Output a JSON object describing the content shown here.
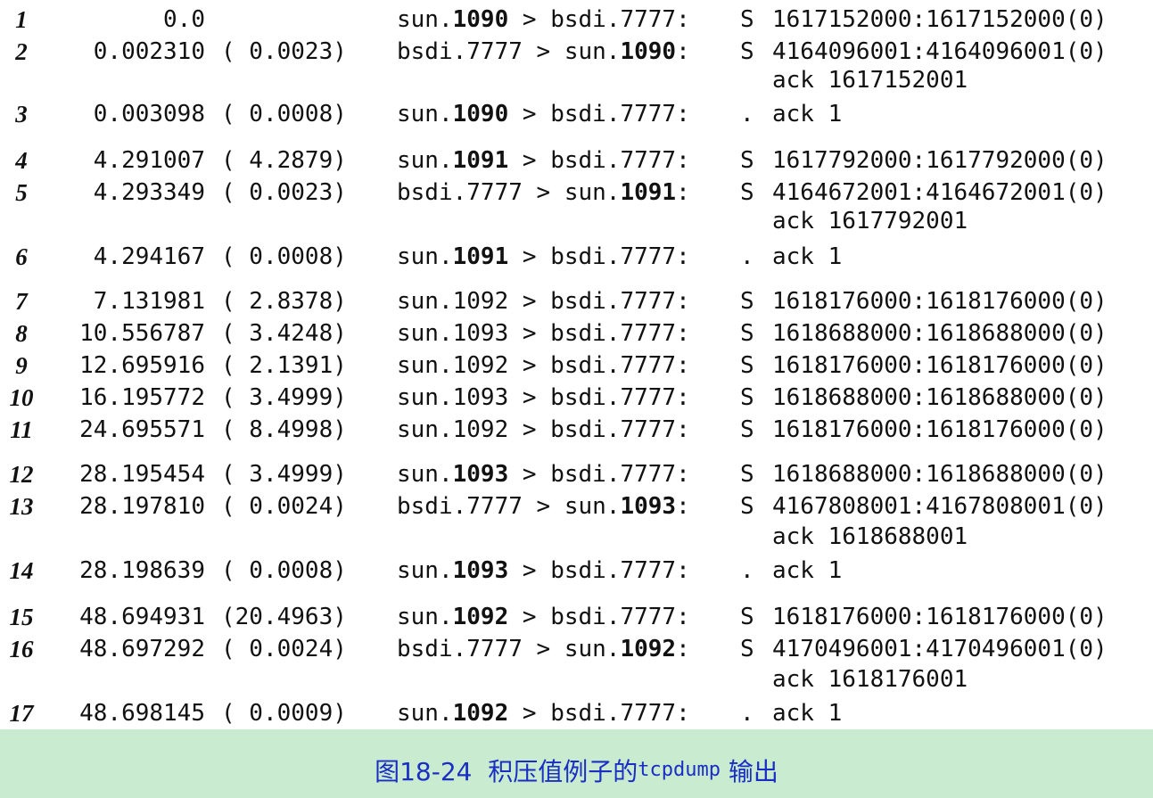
{
  "lines": [
    {
      "n": "1",
      "time": "0.0",
      "delta": "",
      "pre": "sun.",
      "port": "1090",
      "post": " > bsdi.7777:",
      "flag": "S",
      "info": "1617152000:1617152000(0)"
    },
    {
      "n": "2",
      "time": "0.002310",
      "delta": "( 0.0023)",
      "pre": "bsdi.7777 > sun.",
      "port": "1090",
      "post": ":",
      "flag": "S",
      "info": "4164096001:4164096001(0)"
    },
    {
      "n": "",
      "time": "",
      "delta": "",
      "pre": "",
      "port": "",
      "post": "",
      "flag": "",
      "info": "ack 1617152001"
    },
    {
      "n": "3",
      "time": "0.003098",
      "delta": "( 0.0008)",
      "pre": "sun.",
      "port": "1090",
      "post": " > bsdi.7777:",
      "flag": ".",
      "info": "ack 1"
    },
    {
      "n": "4",
      "time": "4.291007",
      "delta": "( 4.2879)",
      "pre": "sun.",
      "port": "1091",
      "post": " > bsdi.7777:",
      "flag": "S",
      "info": "1617792000:1617792000(0)"
    },
    {
      "n": "5",
      "time": "4.293349",
      "delta": "( 0.0023)",
      "pre": "bsdi.7777 > sun.",
      "port": "1091",
      "post": ":",
      "flag": "S",
      "info": "4164672001:4164672001(0)"
    },
    {
      "n": "",
      "time": "",
      "delta": "",
      "pre": "",
      "port": "",
      "post": "",
      "flag": "",
      "info": "ack 1617792001"
    },
    {
      "n": "6",
      "time": "4.294167",
      "delta": "( 0.0008)",
      "pre": "sun.",
      "port": "1091",
      "post": " > bsdi.7777:",
      "flag": ".",
      "info": "ack 1"
    },
    {
      "n": "7",
      "time": "7.131981",
      "delta": "( 2.8378)",
      "pre": "sun.1092 > bsdi.7777:",
      "port": "",
      "post": "",
      "flag": "S",
      "info": "1618176000:1618176000(0)"
    },
    {
      "n": "8",
      "time": "10.556787",
      "delta": "( 3.4248)",
      "pre": "sun.1093 > bsdi.7777:",
      "port": "",
      "post": "",
      "flag": "S",
      "info": "1618688000:1618688000(0)"
    },
    {
      "n": "9",
      "time": "12.695916",
      "delta": "( 2.1391)",
      "pre": "sun.1092 > bsdi.7777:",
      "port": "",
      "post": "",
      "flag": "S",
      "info": "1618176000:1618176000(0)"
    },
    {
      "n": "10",
      "time": "16.195772",
      "delta": "( 3.4999)",
      "pre": "sun.1093 > bsdi.7777:",
      "port": "",
      "post": "",
      "flag": "S",
      "info": "1618688000:1618688000(0)"
    },
    {
      "n": "11",
      "time": "24.695571",
      "delta": "( 8.4998)",
      "pre": "sun.1092 > bsdi.7777:",
      "port": "",
      "post": "",
      "flag": "S",
      "info": "1618176000:1618176000(0)"
    },
    {
      "n": "12",
      "time": "28.195454",
      "delta": "( 3.4999)",
      "pre": "sun.",
      "port": "1093",
      "post": " > bsdi.7777:",
      "flag": "S",
      "info": "1618688000:1618688000(0)"
    },
    {
      "n": "13",
      "time": "28.197810",
      "delta": "( 0.0024)",
      "pre": "bsdi.7777 > sun.",
      "port": "1093",
      "post": ":",
      "flag": "S",
      "info": "4167808001:4167808001(0)"
    },
    {
      "n": "",
      "time": "",
      "delta": "",
      "pre": "",
      "port": "",
      "post": "",
      "flag": "",
      "info": "ack 1618688001"
    },
    {
      "n": "14",
      "time": "28.198639",
      "delta": "( 0.0008)",
      "pre": "sun.",
      "port": "1093",
      "post": " > bsdi.7777:",
      "flag": ".",
      "info": "ack 1"
    },
    {
      "n": "15",
      "time": "48.694931",
      "delta": "(20.4963)",
      "pre": "sun.",
      "port": "1092",
      "post": " > bsdi.7777:",
      "flag": "S",
      "info": "1618176000:1618176000(0)"
    },
    {
      "n": "16",
      "time": "48.697292",
      "delta": "( 0.0024)",
      "pre": "bsdi.7777 > sun.",
      "port": "1092",
      "post": ":",
      "flag": "S",
      "info": "4170496001:4170496001(0)"
    },
    {
      "n": "",
      "time": "",
      "delta": "",
      "pre": "",
      "port": "",
      "post": "",
      "flag": "",
      "info": "ack 1618176001"
    },
    {
      "n": "17",
      "time": "48.698145",
      "delta": "( 0.0009)",
      "pre": "sun.",
      "port": "1092",
      "post": " > bsdi.7777:",
      "flag": ".",
      "info": "ack 1"
    }
  ],
  "caption": {
    "prefix": "图18-24  积压值例子的",
    "command": "tcpdump",
    "suffix": " 输出"
  }
}
